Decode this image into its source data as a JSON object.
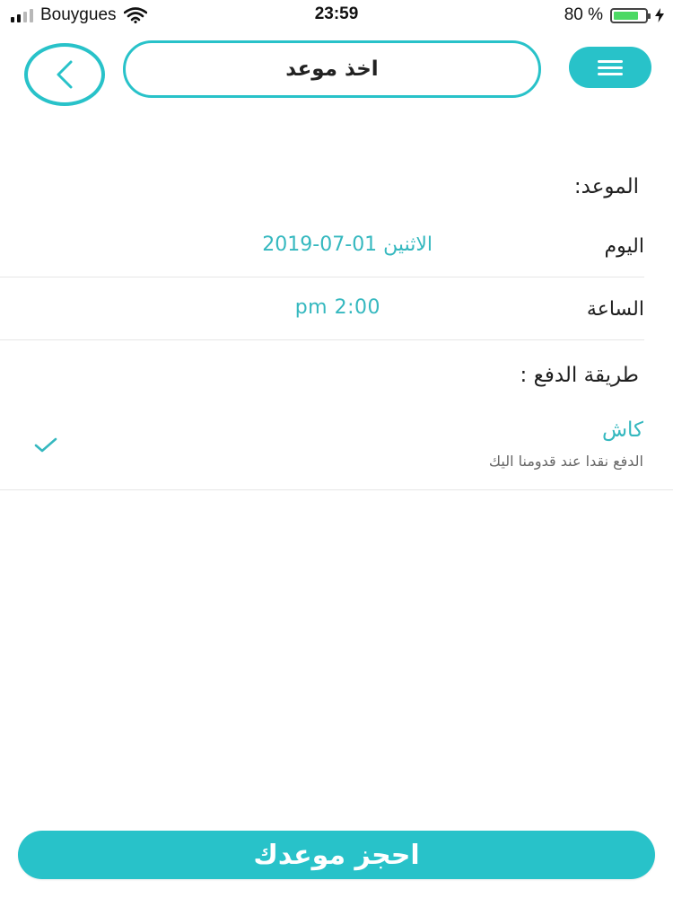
{
  "status_bar": {
    "carrier": "Bouygues",
    "time": "23:59",
    "battery_percent": "80 %",
    "battery_level": 0.8
  },
  "header": {
    "title": "اخذ موعد",
    "back_icon": "chevron-left-icon",
    "menu_icon": "hamburger-icon"
  },
  "appointment": {
    "section_title": "الموعد:",
    "day_label": "اليوم",
    "day_value": "الاثنين 01-07-2019",
    "time_label": "الساعة",
    "time_value": "pm 2:00"
  },
  "payment": {
    "section_title": "طريقة الدفع :",
    "method_name": "كاش",
    "method_desc": "الدفع نقدا عند قدومنا اليك",
    "selected_icon": "checkmark-icon"
  },
  "footer": {
    "book_label": "احجز موعدك"
  },
  "colors": {
    "accent": "#28c2c9",
    "value_text": "#35b8bf"
  }
}
